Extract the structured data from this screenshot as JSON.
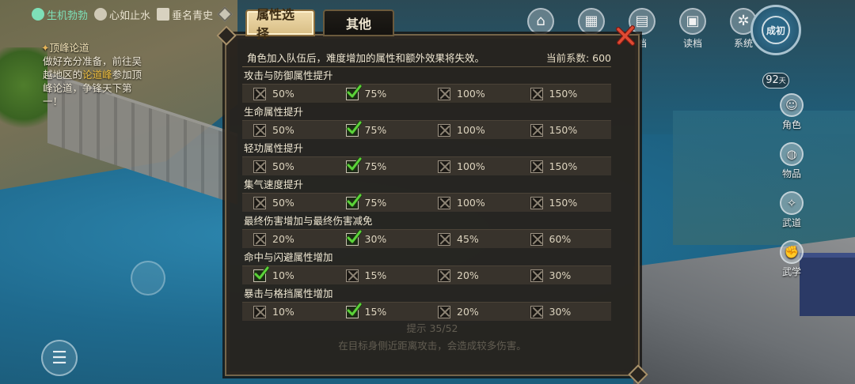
{
  "status_bar": [
    {
      "icon": "heart-icon",
      "label": "生机勃勃",
      "highlight": true
    },
    {
      "icon": "face-icon",
      "label": "心如止水",
      "highlight": false
    },
    {
      "icon": "scroll-icon",
      "label": "垂名青史",
      "highlight": false
    }
  ],
  "quest": {
    "title": "顶峰论道",
    "line1": "做好充分准备，前往吴越地区的",
    "highlight": "论道峰",
    "line2": "参加顶峰论道，争锋天下第一！"
  },
  "top_icons": [
    {
      "icon": "house-icon",
      "label": ""
    },
    {
      "icon": "map-icon",
      "label": ""
    },
    {
      "icon": "save-icon",
      "label": "档"
    },
    {
      "icon": "load-icon",
      "label": "读档"
    },
    {
      "icon": "gear-icon",
      "label": "系统"
    }
  ],
  "compass": {
    "label": "成初"
  },
  "day": {
    "value": "92",
    "unit": "天"
  },
  "side_nav": [
    {
      "icon": "person-icon",
      "label": "角色"
    },
    {
      "icon": "bag-icon",
      "label": "物品"
    },
    {
      "icon": "martial-icon",
      "label": "武道"
    },
    {
      "icon": "fist-icon",
      "label": "武学"
    }
  ],
  "dialog": {
    "tabs": [
      {
        "label": "属性选择",
        "active": true
      },
      {
        "label": "其他",
        "active": false
      }
    ],
    "notice": "角色加入队伍后，难度增加的属性和额外效果将失效。",
    "coefficient_label": "当前系数:",
    "coefficient_value": "600",
    "sections": [
      {
        "title": "攻击与防御属性提升",
        "options": [
          {
            "label": "50%",
            "checked": false
          },
          {
            "label": "75%",
            "checked": true
          },
          {
            "label": "100%",
            "checked": false
          },
          {
            "label": "150%",
            "checked": false
          }
        ]
      },
      {
        "title": "生命属性提升",
        "options": [
          {
            "label": "50%",
            "checked": false
          },
          {
            "label": "75%",
            "checked": true
          },
          {
            "label": "100%",
            "checked": false
          },
          {
            "label": "150%",
            "checked": false
          }
        ]
      },
      {
        "title": "轻功属性提升",
        "options": [
          {
            "label": "50%",
            "checked": false
          },
          {
            "label": "75%",
            "checked": true
          },
          {
            "label": "100%",
            "checked": false
          },
          {
            "label": "150%",
            "checked": false
          }
        ]
      },
      {
        "title": "集气速度提升",
        "options": [
          {
            "label": "50%",
            "checked": false
          },
          {
            "label": "75%",
            "checked": true
          },
          {
            "label": "100%",
            "checked": false
          },
          {
            "label": "150%",
            "checked": false
          }
        ]
      },
      {
        "title": "最终伤害增加与最终伤害减免",
        "options": [
          {
            "label": "20%",
            "checked": false
          },
          {
            "label": "30%",
            "checked": true
          },
          {
            "label": "45%",
            "checked": false
          },
          {
            "label": "60%",
            "checked": false
          }
        ]
      },
      {
        "title": "命中与闪避属性增加",
        "options": [
          {
            "label": "10%",
            "checked": true
          },
          {
            "label": "15%",
            "checked": false
          },
          {
            "label": "20%",
            "checked": false
          },
          {
            "label": "30%",
            "checked": false
          }
        ]
      },
      {
        "title": "暴击与格挡属性增加",
        "options": [
          {
            "label": "10%",
            "checked": false
          },
          {
            "label": "15%",
            "checked": true
          },
          {
            "label": "20%",
            "checked": false
          },
          {
            "label": "30%",
            "checked": false
          }
        ]
      }
    ],
    "footer_hint_1": "提示 35/52",
    "footer_hint_2": "在目标身侧近距离攻击，会造成较多伤害。"
  },
  "colors": {
    "accent_gold": "#d8bd84",
    "check_green": "#5bd33a",
    "close_red": "#d8352a",
    "panel_bg": "#26221d"
  }
}
